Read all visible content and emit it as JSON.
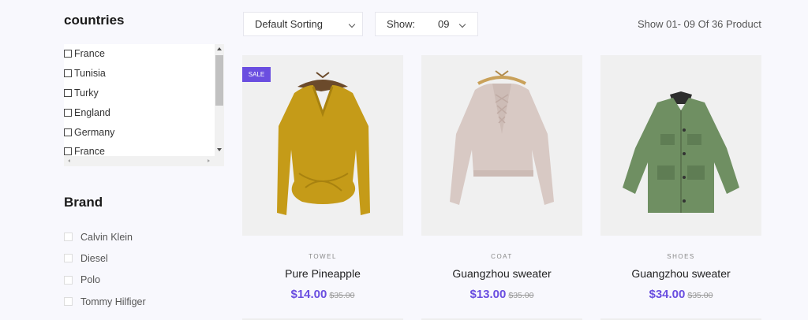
{
  "sidebar": {
    "countries_title": "countries",
    "countries": [
      "France",
      "Tunisia",
      "Turky",
      "England",
      "Germany",
      "France"
    ],
    "brand_title": "Brand",
    "brands": [
      "Calvin Klein",
      "Diesel",
      "Polo",
      "Tommy Hilfiger"
    ]
  },
  "toolbar": {
    "sorting_label": "Default Sorting",
    "show_label": "Show:",
    "show_value": "09",
    "result_text": "Show 01- 09 Of 36 Product"
  },
  "products": [
    {
      "category": "TOWEL",
      "name": "Pure Pineapple",
      "price": "$14.00",
      "old_price": "$35.00",
      "badge": "SALE",
      "image": "mustard-sweater"
    },
    {
      "category": "COAT",
      "name": "Guangzhou sweater",
      "price": "$13.00",
      "old_price": "$35.00",
      "image": "pink-lace-up-sweater"
    },
    {
      "category": "SHOES",
      "name": "Guangzhou sweater",
      "price": "$34.00",
      "old_price": "$35.00",
      "image": "green-jacket"
    }
  ],
  "colors": {
    "accent": "#6a4ee0",
    "background": "#f8f8fd"
  }
}
